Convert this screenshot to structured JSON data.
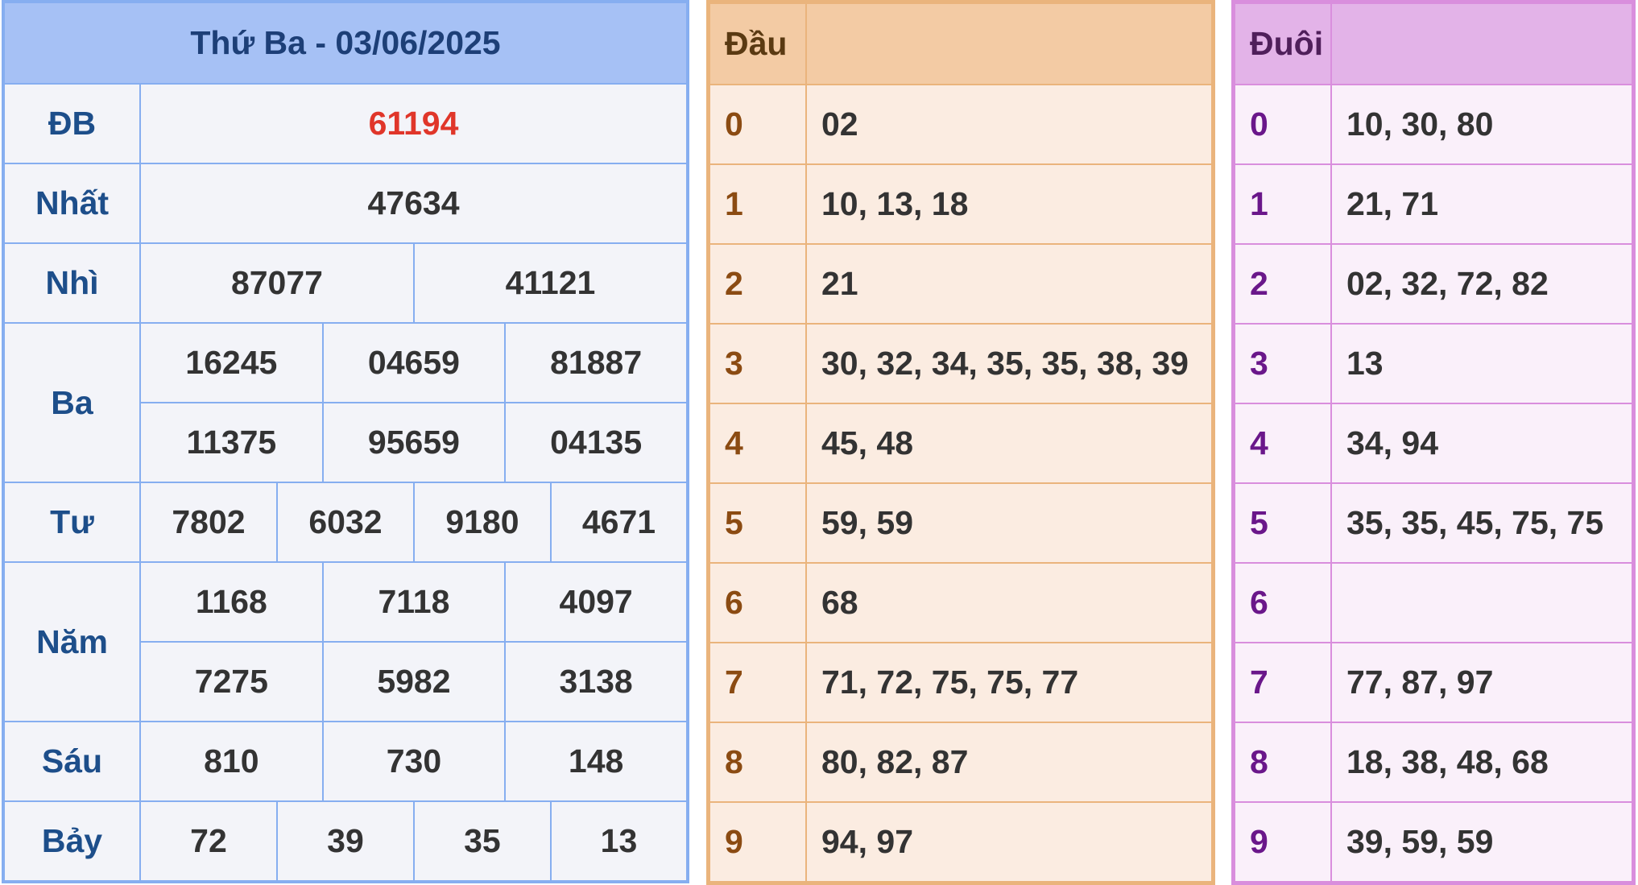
{
  "title": "Thứ Ba - 03/06/2025",
  "colors": {
    "special_prize": "#e0362a",
    "label": "#1d4e8a"
  },
  "prizes": {
    "db": {
      "label": "ĐB",
      "values": [
        "61194"
      ]
    },
    "nhat": {
      "label": "Nhất",
      "values": [
        "47634"
      ]
    },
    "nhi": {
      "label": "Nhì",
      "values": [
        "87077",
        "41121"
      ]
    },
    "ba": {
      "label": "Ba",
      "values": [
        "16245",
        "04659",
        "81887",
        "11375",
        "95659",
        "04135"
      ]
    },
    "tu": {
      "label": "Tư",
      "values": [
        "7802",
        "6032",
        "9180",
        "4671"
      ]
    },
    "nam": {
      "label": "Năm",
      "values": [
        "1168",
        "7118",
        "4097",
        "7275",
        "5982",
        "3138"
      ]
    },
    "sau": {
      "label": "Sáu",
      "values": [
        "810",
        "730",
        "148"
      ]
    },
    "bay": {
      "label": "Bảy",
      "values": [
        "72",
        "39",
        "35",
        "13"
      ]
    }
  },
  "head_table": {
    "header": "Đầu",
    "rows": [
      {
        "key": "0",
        "value": "02"
      },
      {
        "key": "1",
        "value": "10, 13, 18"
      },
      {
        "key": "2",
        "value": "21"
      },
      {
        "key": "3",
        "value": "30, 32, 34, 35, 35, 38, 39"
      },
      {
        "key": "4",
        "value": "45, 48"
      },
      {
        "key": "5",
        "value": "59, 59"
      },
      {
        "key": "6",
        "value": "68"
      },
      {
        "key": "7",
        "value": "71, 72, 75, 75, 77"
      },
      {
        "key": "8",
        "value": "80, 82, 87"
      },
      {
        "key": "9",
        "value": "94, 97"
      }
    ]
  },
  "tail_table": {
    "header": "Đuôi",
    "rows": [
      {
        "key": "0",
        "value": "10, 30, 80"
      },
      {
        "key": "1",
        "value": "21, 71"
      },
      {
        "key": "2",
        "value": "02, 32, 72, 82"
      },
      {
        "key": "3",
        "value": "13"
      },
      {
        "key": "4",
        "value": "34, 94"
      },
      {
        "key": "5",
        "value": "35, 35, 45, 75, 75"
      },
      {
        "key": "6",
        "value": ""
      },
      {
        "key": "7",
        "value": "77, 87, 97"
      },
      {
        "key": "8",
        "value": "18, 38, 48, 68"
      },
      {
        "key": "9",
        "value": "39, 59, 59"
      }
    ]
  }
}
